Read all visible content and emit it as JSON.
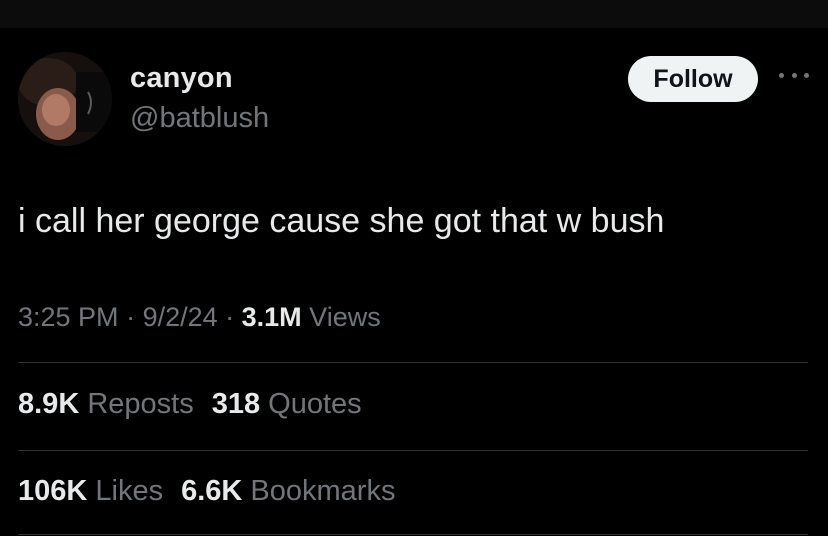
{
  "author": {
    "name": "canyon",
    "handle": "@batblush"
  },
  "actions": {
    "follow_label": "Follow",
    "more_icon": "more-horizontal-icon"
  },
  "tweet": {
    "text": "i call her george cause she got that w bush",
    "time": "3:25 PM",
    "sep1": " · ",
    "date": "9/2/24",
    "sep2": " · ",
    "views_count": "3.1M",
    "views_label": " Views"
  },
  "stats": {
    "reposts_count": "8.9K",
    "reposts_label": " Reposts",
    "quotes_count": "318",
    "quotes_label": " Quotes",
    "likes_count": "106K",
    "likes_label": " Likes",
    "bookmarks_count": "6.6K",
    "bookmarks_label": " Bookmarks"
  },
  "colors": {
    "background": "#000000",
    "text_primary": "#e7e9ea",
    "text_secondary": "#71767b",
    "divider": "#2f3336",
    "button_bg": "#eff3f4"
  }
}
